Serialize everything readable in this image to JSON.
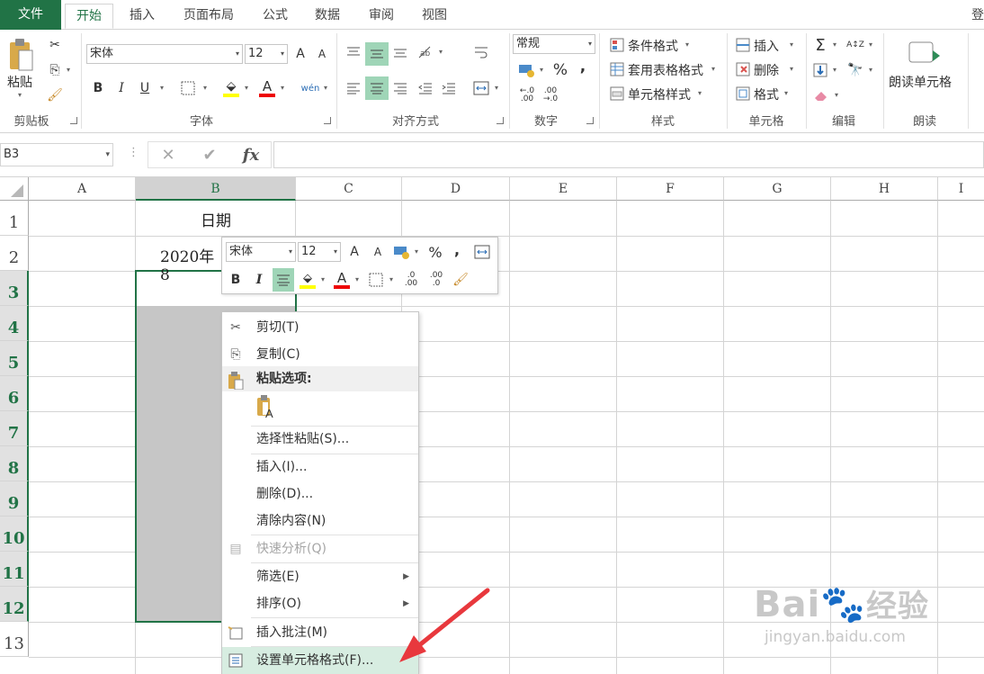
{
  "tabs": {
    "file": "文件",
    "home": "开始",
    "insert": "插入",
    "page_layout": "页面布局",
    "formulas": "公式",
    "data": "数据",
    "review": "审阅",
    "view": "视图",
    "corner": "登"
  },
  "ribbon": {
    "clipboard": {
      "paste": "粘贴",
      "label": "剪贴板"
    },
    "font": {
      "name": "宋体",
      "size": "12",
      "grow": "A",
      "shrink": "A",
      "bold": "B",
      "italic": "I",
      "underline": "U",
      "font_color_glyph": "A",
      "phonetic": "wén",
      "label": "字体"
    },
    "alignment": {
      "label": "对齐方式"
    },
    "number": {
      "format": "常规",
      "percent": "%",
      "comma": ",",
      "inc": ".0",
      "dec": ".00",
      "label": "数字"
    },
    "styles": {
      "conditional": "条件格式",
      "table": "套用表格格式",
      "cell_styles": "单元格样式",
      "label": "样式"
    },
    "cells": {
      "insert": "插入",
      "delete": "删除",
      "format": "格式",
      "label": "单元格"
    },
    "editing": {
      "sigma": "Σ",
      "label": "编辑"
    },
    "readout": {
      "btn": "朗读单元格",
      "label": "朗读"
    }
  },
  "formula_bar": {
    "name_box": "B3",
    "cancel": "✕",
    "enter": "✔",
    "fx": "fx",
    "value": ""
  },
  "grid": {
    "columns": [
      "A",
      "B",
      "C",
      "D",
      "E",
      "F",
      "G",
      "H",
      "I"
    ],
    "selected_column": "B",
    "rows": [
      "1",
      "2",
      "3",
      "4",
      "5",
      "6",
      "7",
      "8",
      "9",
      "10",
      "11",
      "12",
      "13"
    ],
    "cells": {
      "B1": "日期",
      "B2": "2020年8"
    }
  },
  "mini_toolbar": {
    "font": "宋体",
    "size": "12",
    "grow": "A",
    "shrink": "A",
    "percent": "%",
    "comma": ",",
    "bold": "B",
    "italic": "I",
    "font_color": "A",
    "inc": ".0",
    "dec": ".00"
  },
  "context_menu": {
    "cut": "剪切(T)",
    "copy": "复制(C)",
    "paste_options": "粘贴选项:",
    "paste_special": "选择性粘贴(S)...",
    "insert": "插入(I)...",
    "delete": "删除(D)...",
    "clear": "清除内容(N)",
    "quick_analysis": "快速分析(Q)",
    "filter": "筛选(E)",
    "sort": "排序(O)",
    "insert_comment": "插入批注(M)",
    "format_cells": "设置单元格格式(F)..."
  },
  "watermark": {
    "brand": "Bai",
    "brand_cn": "经验",
    "url": "jingyan.baidu.com"
  },
  "colors": {
    "accent": "#217346",
    "selection": "#c6c6c6",
    "arrow": "#e8383d"
  }
}
